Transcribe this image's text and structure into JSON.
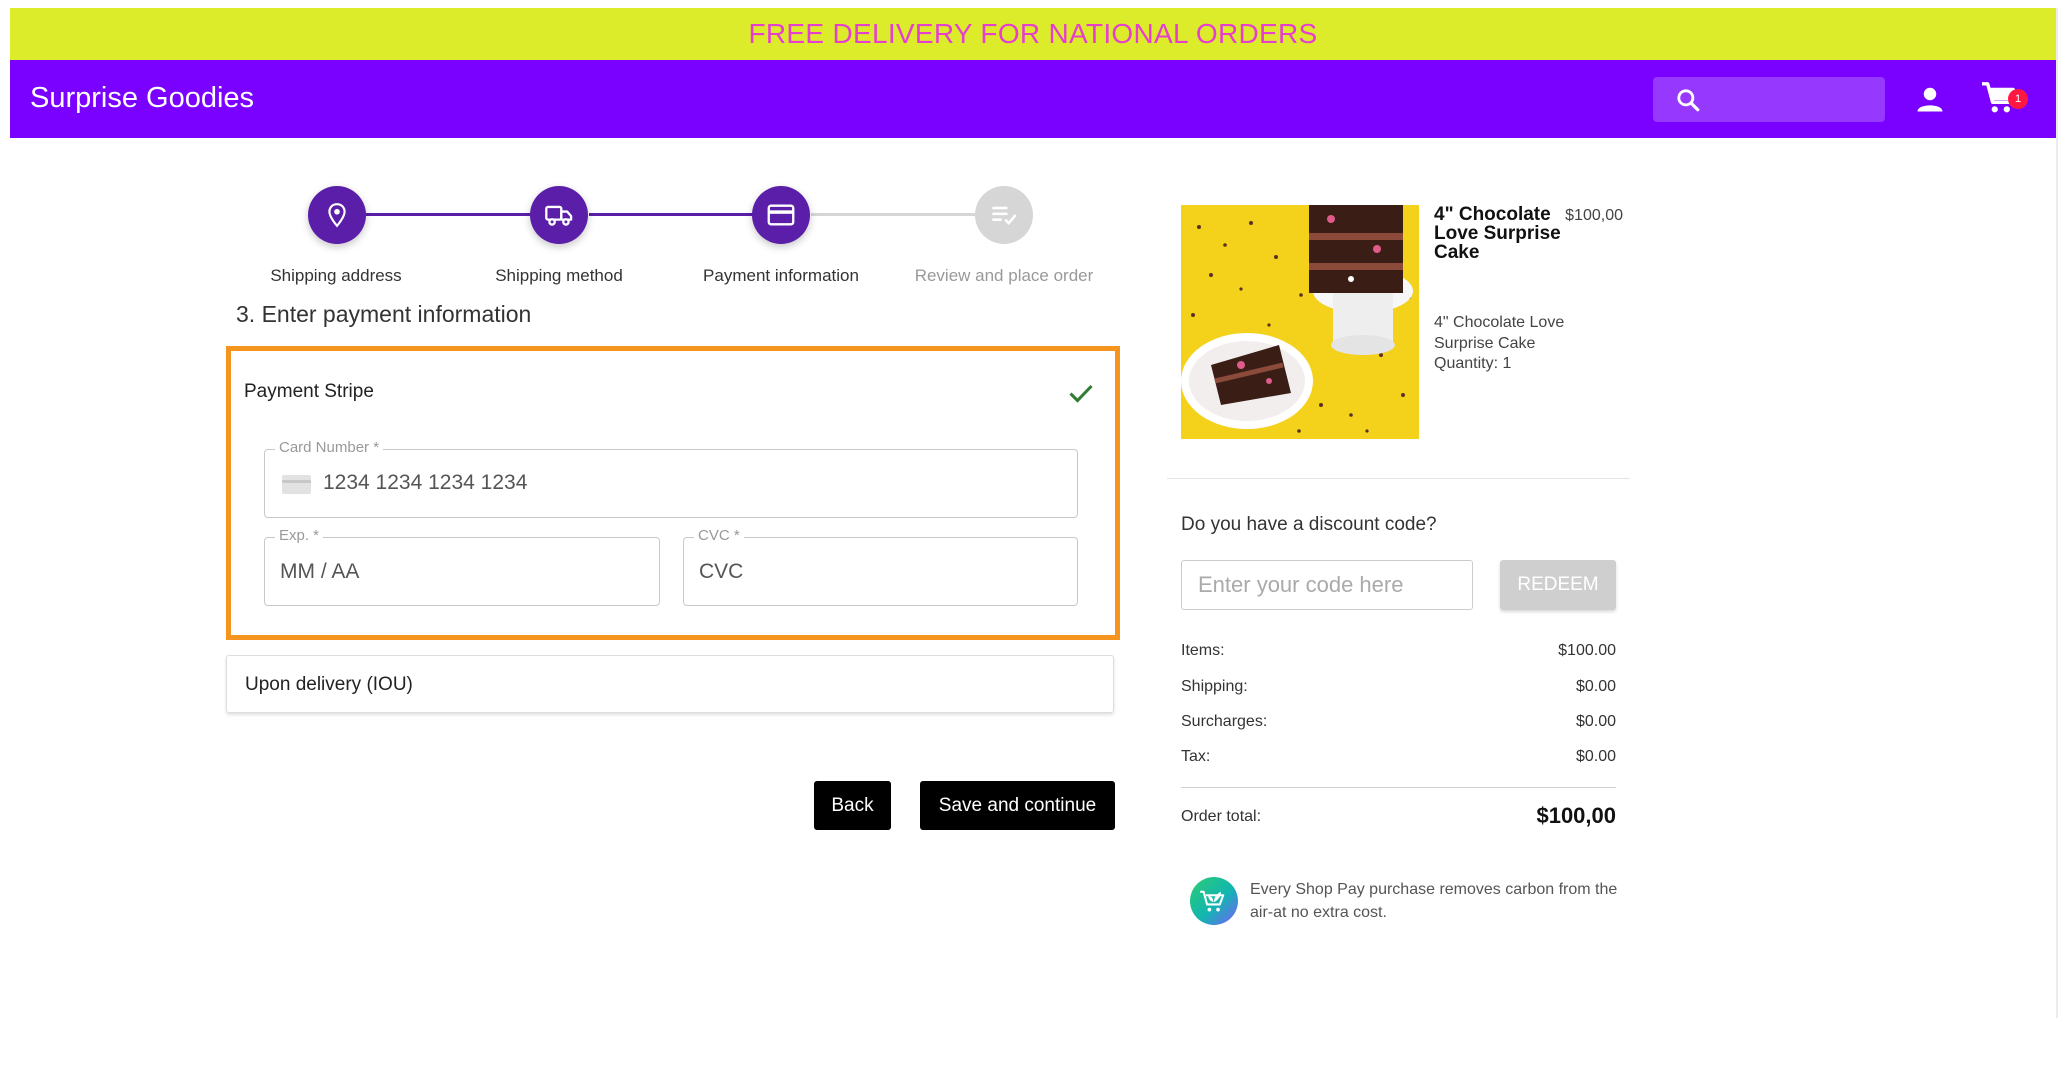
{
  "promo_banner": "FREE DELIVERY FOR NATIONAL ORDERS",
  "header": {
    "brand": "Surprise Goodies",
    "search_placeholder": "",
    "cart_count": "1"
  },
  "stepper": {
    "steps": [
      {
        "label": "Shipping address",
        "icon": "location-pin-icon",
        "state": "complete"
      },
      {
        "label": "Shipping method",
        "icon": "truck-icon",
        "state": "complete"
      },
      {
        "label": "Payment information",
        "icon": "credit-card-icon",
        "state": "current"
      },
      {
        "label": "Review and place order",
        "icon": "checklist-icon",
        "state": "upcoming"
      }
    ]
  },
  "section_title": "3. Enter payment information",
  "payment": {
    "stripe_title": "Payment Stripe",
    "card_number_label": "Card Number *",
    "card_number_placeholder": "1234 1234 1234 1234",
    "exp_label": "Exp. *",
    "exp_placeholder": "MM / AA",
    "cvc_label": "CVC *",
    "cvc_placeholder": "CVC",
    "iou_title": "Upon delivery (IOU)"
  },
  "actions": {
    "back": "Back",
    "save": "Save and continue"
  },
  "cart": {
    "product_title": "4\" Chocolate Love Surprise Cake",
    "product_desc": "4\" Chocolate Love Surprise Cake",
    "quantity": "Quantity: 1",
    "price": "$100,00"
  },
  "discount": {
    "question": "Do you have a discount code?",
    "placeholder": "Enter your code here",
    "redeem": "REDEEM"
  },
  "summary": {
    "rows": [
      {
        "label": "Items:",
        "value": "$100.00"
      },
      {
        "label": "Shipping:",
        "value": "$0.00"
      },
      {
        "label": "Surcharges:",
        "value": "$0.00"
      },
      {
        "label": "Tax:",
        "value": "$0.00"
      }
    ],
    "total_label": "Order total:",
    "total_value": "$100,00"
  },
  "eco_message": "Every Shop Pay purchase removes carbon from the air-at no extra cost.",
  "colors": {
    "banner_bg": "#dcec2b",
    "banner_text": "#e63fd0",
    "header_bg": "#7a00ff",
    "step_active": "#5a1ea8",
    "step_inactive": "#d6d6d6",
    "panel_border": "#f5941e",
    "check_green": "#2e7d32",
    "badge_red": "#ff1744"
  }
}
